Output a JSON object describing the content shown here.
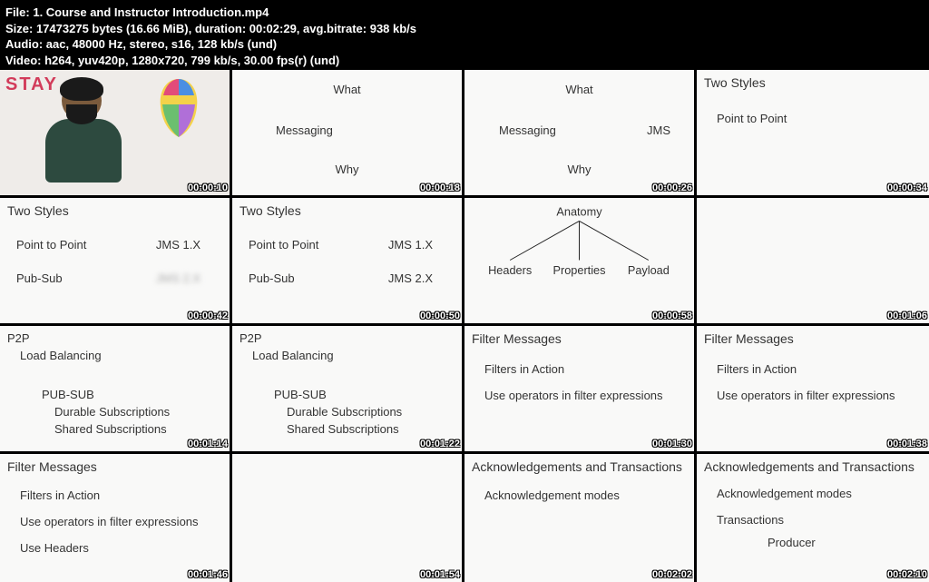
{
  "header": {
    "line1": "File: 1. Course and Instructor Introduction.mp4",
    "line2": "Size: 17473275 bytes (16.66 MiB), duration: 00:02:29, avg.bitrate: 938 kb/s",
    "line3": "Audio: aac, 48000 Hz, stereo, s16, 128 kb/s (und)",
    "line4": "Video: h264, yuv420p, 1280x720, 799 kb/s, 30.00 fps(r) (und)"
  },
  "stay_text": "STAY",
  "cells": [
    {
      "ts": "00:00:10"
    },
    {
      "ts": "00:00:18",
      "t1": "What",
      "t2": "Messaging",
      "t3": "Why"
    },
    {
      "ts": "00:00:26",
      "t1": "What",
      "t2": "Messaging",
      "t2b": "JMS",
      "t3": "Why"
    },
    {
      "ts": "00:00:34",
      "title": "Two Styles",
      "l1": "Point to Point"
    },
    {
      "ts": "00:00:42",
      "title": "Two Styles",
      "l1": "Point to Point",
      "r1": "JMS 1.X",
      "l2": "Pub-Sub",
      "r2blur": "true"
    },
    {
      "ts": "00:00:50",
      "title": "Two Styles",
      "l1": "Point to Point",
      "r1": "JMS 1.X",
      "l2": "Pub-Sub",
      "r2": "JMS 2.X"
    },
    {
      "ts": "00:00:58",
      "a_top": "Anatomy",
      "a1": "Headers",
      "a2": "Properties",
      "a3": "Payload"
    },
    {
      "ts": "00:01:06"
    },
    {
      "ts": "00:01:14",
      "h1": "P2P",
      "p1": "Load Balancing",
      "h2": "PUB-SUB",
      "p2": "Durable Subscriptions",
      "p3": "Shared Subscriptions"
    },
    {
      "ts": "00:01:22",
      "h1": "P2P",
      "p1": "Load Balancing",
      "h2": "PUB-SUB",
      "p2": "Durable Subscriptions",
      "p3": "Shared Subscriptions"
    },
    {
      "ts": "00:01:30",
      "title": "Filter Messages",
      "l1": "Filters in Action",
      "l2": "Use operators in filter expressions"
    },
    {
      "ts": "00:01:38",
      "title": "Filter Messages",
      "l1": "Filters in Action",
      "l2": "Use operators in filter expressions"
    },
    {
      "ts": "00:01:46",
      "title": "Filter Messages",
      "l1": "Filters in Action",
      "l2": "Use operators in filter expressions",
      "l3": "Use Headers"
    },
    {
      "ts": "00:01:54"
    },
    {
      "ts": "00:02:02",
      "title": "Acknowledgements and Transactions",
      "l1": "Acknowledgement modes"
    },
    {
      "ts": "00:02:10",
      "title": "Acknowledgements and Transactions",
      "l1": "Acknowledgement modes",
      "l2": "Transactions",
      "l3": "Producer"
    }
  ]
}
